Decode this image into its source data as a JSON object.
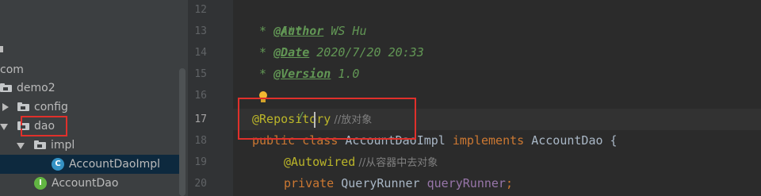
{
  "project_tree": {
    "rows": [
      {
        "label": "com",
        "type": "package"
      },
      {
        "label": "demo2",
        "type": "folder"
      },
      {
        "label": "config",
        "type": "folder",
        "state": "collapsed"
      },
      {
        "label": "dao",
        "type": "folder",
        "state": "expanded"
      },
      {
        "label": "impl",
        "type": "folder",
        "state": "expanded"
      },
      {
        "label": "AccountDaoImpl",
        "type": "class",
        "icon_letter": "C",
        "selected": true
      },
      {
        "label": "AccountDao",
        "type": "interface",
        "icon_letter": "I"
      }
    ]
  },
  "editor": {
    "line_numbers": [
      "12",
      "13",
      "14",
      "15",
      "16",
      "17",
      "18",
      "19",
      "20"
    ],
    "current_line": "17",
    "lines": {
      "l12": "/**",
      "l13_prefix": " * ",
      "l13_tag": "@Author",
      "l13_text": " WS Hu",
      "l14_prefix": " * ",
      "l14_tag": "@Date",
      "l14_text": " 2020/7/20 20:33",
      "l15_prefix": " * ",
      "l15_tag": "@Version",
      "l15_text": " 1.0",
      "l16_end": "/",
      "l17_annotation": "@Repository",
      "l17_comment": " //放对象",
      "l18_kw1": "public class ",
      "l18_name": "AccountDaoImpl ",
      "l18_kw2": "implements ",
      "l18_iface": "AccountDao {",
      "l19_annotation": "@Autowired",
      "l19_comment": " //从容器中去对象",
      "l20_kw": "private ",
      "l20_type": "QueryRunner ",
      "l20_field": "queryRunner",
      "l20_end": ";"
    }
  },
  "colors": {
    "highlight_box": "#e0302b",
    "selected_row": "#0d293e",
    "annotation": "#bbb529",
    "keyword": "#cc7832",
    "doc_comment": "#629755"
  }
}
